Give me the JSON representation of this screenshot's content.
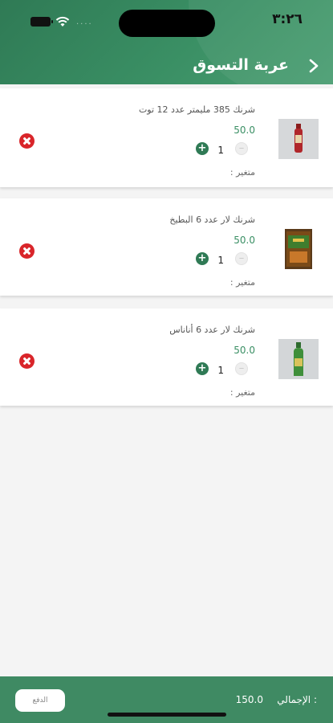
{
  "status_bar": {
    "time": "٣:٢٦",
    "signal_dots": "....",
    "battery_icon": "battery-icon",
    "wifi_icon": "wifi-icon"
  },
  "header": {
    "title": "عربة التسوق",
    "back_icon": "chevron-right-icon"
  },
  "cart_items": [
    {
      "name": "شرنك 385 مليمتر عدد 12 توت",
      "price": "50.0",
      "quantity": "1",
      "variant_label": "متغير :",
      "thumb_desc": "red-bottle"
    },
    {
      "name": "شرنك لار عدد 6 البطيخ",
      "price": "50.0",
      "quantity": "1",
      "variant_label": "متغير :",
      "thumb_desc": "pack"
    },
    {
      "name": "شرنك لار عدد 6 أناناس",
      "price": "50.0",
      "quantity": "1",
      "variant_label": "متغير :",
      "thumb_desc": "green-bottle"
    }
  ],
  "footer": {
    "pay_label": "الدفع",
    "total_label": "الإجمالي :",
    "total_value": "150.0"
  },
  "colors": {
    "primary": "#3a8f64",
    "dark_primary": "#2f7a55",
    "remove": "#d9252a"
  }
}
